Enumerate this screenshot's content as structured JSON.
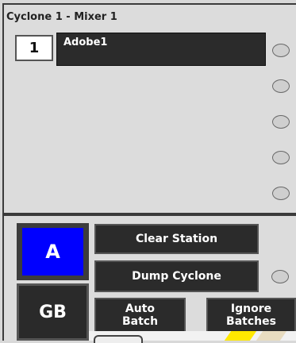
{
  "window": {
    "title": "Cyclone 1 - Mixer 1"
  },
  "station": {
    "number": "1",
    "recipe": "Adobe1"
  },
  "buttons": {
    "mode_a": "A",
    "gb": "GB",
    "clear_station": "Clear Station",
    "dump_cyclone": "Dump Cyclone",
    "auto_batch": "Auto\nBatch",
    "ignore_batches": "Ignore\nBatches"
  },
  "colors": {
    "mode_a_bg": "#0000ff",
    "button_bg": "#2b2b2b",
    "panel_bg": "#dcdcdc"
  }
}
